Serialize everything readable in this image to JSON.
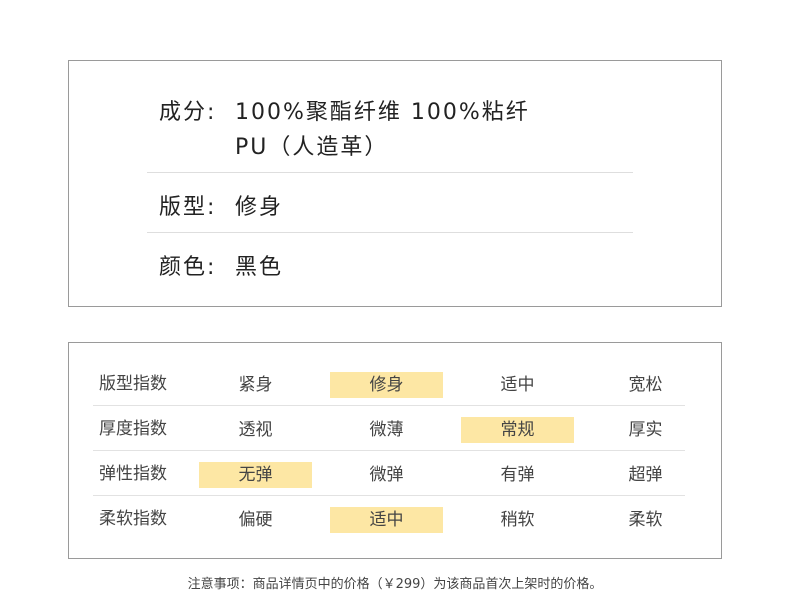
{
  "attributes": {
    "composition": {
      "label": "成分:",
      "line1": "100%聚酯纤维 100%粘纤",
      "line2": "PU（人造革）"
    },
    "fit": {
      "label": "版型:",
      "value": "修身"
    },
    "color": {
      "label": "颜色:",
      "value": "黑色"
    }
  },
  "indices": [
    {
      "label": "版型指数",
      "options": [
        "紧身",
        "修身",
        "适中",
        "宽松"
      ],
      "selected_index": 1
    },
    {
      "label": "厚度指数",
      "options": [
        "透视",
        "微薄",
        "常规",
        "厚实"
      ],
      "selected_index": 2
    },
    {
      "label": "弹性指数",
      "options": [
        "无弹",
        "微弹",
        "有弹",
        "超弹"
      ],
      "selected_index": 0
    },
    {
      "label": "柔软指数",
      "options": [
        "偏硬",
        "适中",
        "稍软",
        "柔软"
      ],
      "selected_index": 1
    }
  ],
  "note": "注意事项：商品详情页中的价格（￥299）为该商品首次上架时的价格。",
  "colors": {
    "highlight": "#fde7a4",
    "border": "#9a9a9a",
    "text": "#333333"
  }
}
